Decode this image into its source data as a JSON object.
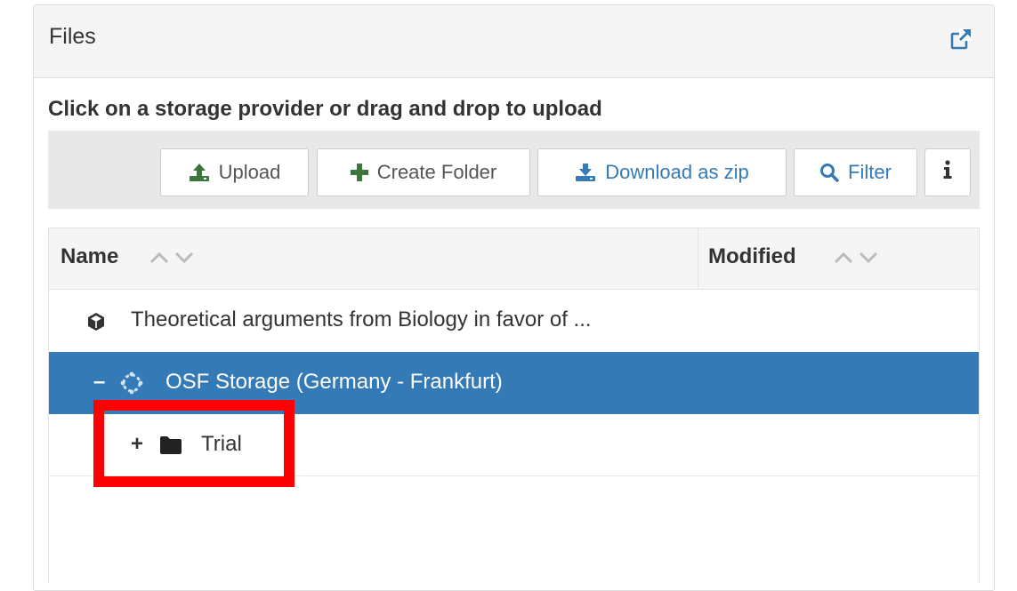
{
  "panel": {
    "title": "Files",
    "external_link_icon": "external-link-icon"
  },
  "instruction": "Click on a storage provider or drag and drop to upload",
  "toolbar": {
    "upload_label": "Upload",
    "create_folder_label": "Create Folder",
    "download_zip_label": "Download as zip",
    "filter_label": "Filter",
    "info_icon": "info-icon"
  },
  "grid": {
    "columns": {
      "name": "Name",
      "modified": "Modified"
    },
    "rows": [
      {
        "type": "project",
        "icon": "cube-icon",
        "label": "Theoretical arguments from Biology in favor of ..."
      },
      {
        "type": "storage",
        "toggle": "–",
        "icon": "osf-storage-icon",
        "label": "OSF Storage (Germany - Frankfurt)",
        "selected": true
      },
      {
        "type": "folder",
        "toggle": "+",
        "icon": "folder-icon",
        "label": "Trial"
      }
    ]
  },
  "colors": {
    "selected_row": "#337ab7",
    "highlight": "#ff0000",
    "upload_icon": "#3c763d",
    "create_folder_icon": "#3c763d",
    "download_icon": "#337ab7",
    "filter_icon": "#337ab7"
  }
}
